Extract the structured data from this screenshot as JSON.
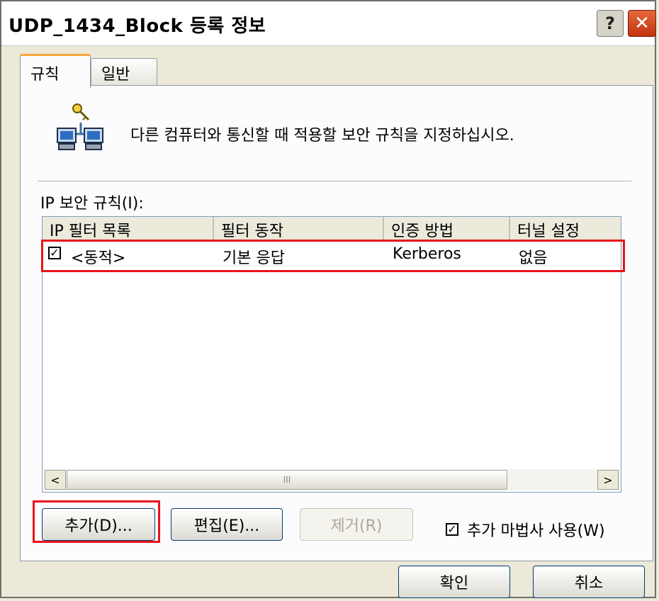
{
  "window": {
    "title": "UDP_1434_Block 등록 정보",
    "help_glyph": "?",
    "close_glyph": "✕"
  },
  "tabs": [
    {
      "label": "규칙",
      "active": true
    },
    {
      "label": "일반",
      "active": false
    }
  ],
  "rules_tab": {
    "description": "다른 컴퓨터와 통신할 때 적용할 보안 규칙을 지정하십시오.",
    "list_label": "IP 보안 규칙(I):",
    "columns": [
      "IP 필터 목록",
      "필터 동작",
      "인증 방법",
      "터널 설정"
    ],
    "rows": [
      {
        "checked": true,
        "check_glyph": "✓",
        "filter_list": "<동적>",
        "filter_action": "기본 응답",
        "auth_method": "Kerberos",
        "tunnel": "없음"
      }
    ],
    "scroll_left_glyph": "<",
    "scroll_right_glyph": ">",
    "scroll_grip_glyph": "III",
    "buttons": {
      "add": "추가(D)...",
      "edit": "편집(E)...",
      "remove": "제거(R)"
    },
    "wizard_checkbox": {
      "checked": true,
      "check_glyph": "✓",
      "label": "추가 마법사 사용(W)"
    }
  },
  "footer": {
    "ok": "확인",
    "cancel": "취소"
  },
  "colors": {
    "highlight": "#e8141a",
    "tab_accent": "#f7a53b",
    "close_button": "#c2340f"
  }
}
